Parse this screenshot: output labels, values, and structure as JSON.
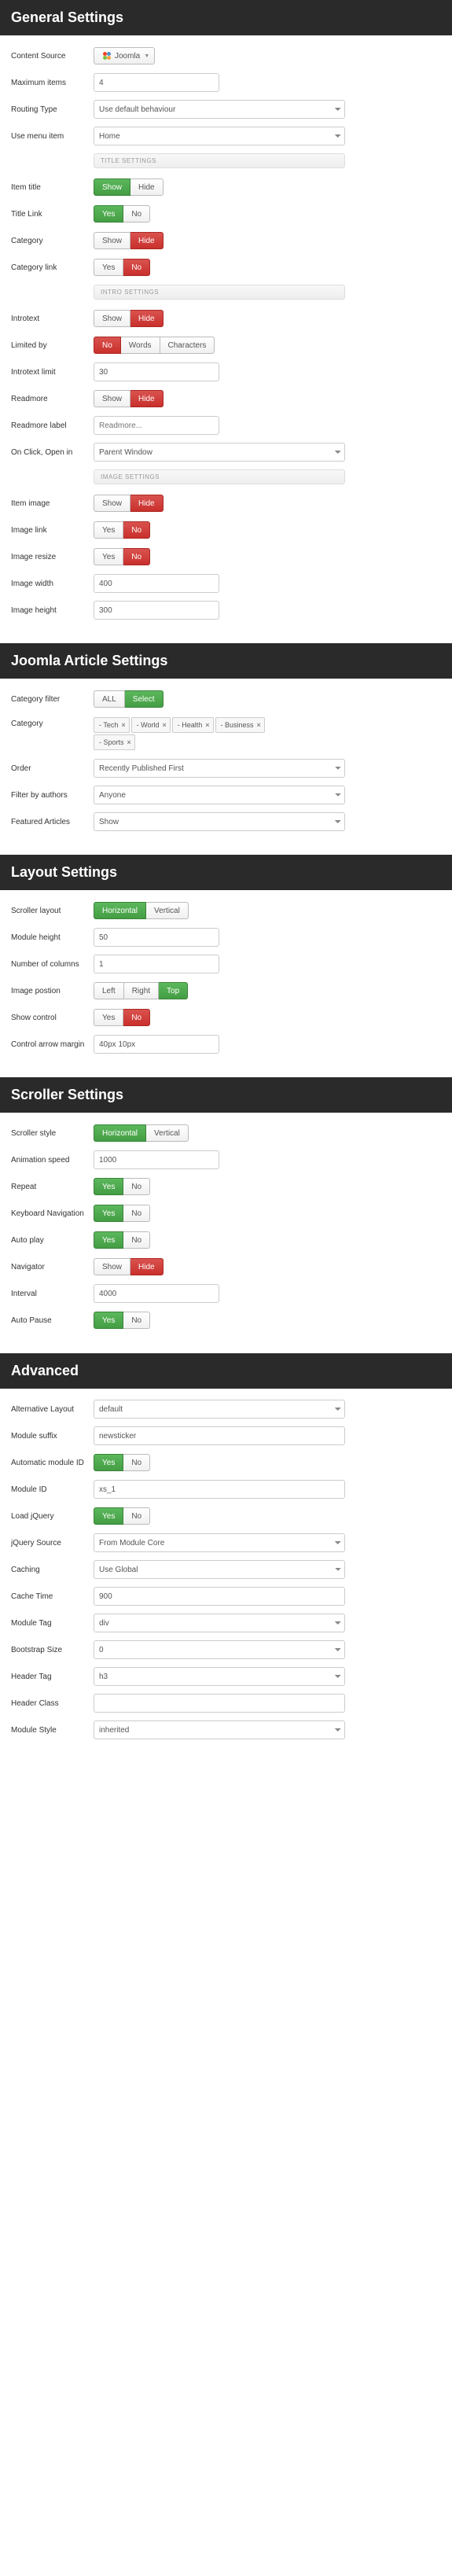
{
  "sections": {
    "general": {
      "title": "General Settings",
      "content_source_label": "Content Source",
      "content_source_value": "Joomla",
      "max_items_label": "Maximum items",
      "max_items_value": "4",
      "routing_type_label": "Routing Type",
      "routing_type_value": "Use default behaviour",
      "use_menu_label": "Use menu item",
      "use_menu_value": "Home",
      "title_settings_divider": "TITLE SETTINGS",
      "item_title_label": "Item title",
      "title_link_label": "Title Link",
      "category_label": "Category",
      "category_link_label": "Category link",
      "intro_settings_divider": "INTRO SETTINGS",
      "introtext_label": "Introtext",
      "limited_by_label": "Limited by",
      "limited_words": "Words",
      "limited_chars": "Characters",
      "introtext_limit_label": "Introtext limit",
      "introtext_limit_value": "30",
      "readmore_label": "Readmore",
      "readmore_label_label": "Readmore label",
      "readmore_label_placeholder": "Readmore...",
      "on_click_label": "On Click, Open in",
      "on_click_value": "Parent Window",
      "image_settings_divider": "IMAGE SETTINGS",
      "item_image_label": "Item image",
      "image_link_label": "Image link",
      "image_resize_label": "Image resize",
      "image_width_label": "Image width",
      "image_width_value": "400",
      "image_height_label": "Image height",
      "image_height_value": "300"
    },
    "joomla": {
      "title": "Joomla Article Settings",
      "category_filter_label": "Category filter",
      "all": "ALL",
      "select": "Select",
      "category_label": "Category",
      "tags": [
        "- Tech",
        "- World",
        "- Health",
        "- Business",
        "- Sports"
      ],
      "order_label": "Order",
      "order_value": "Recently Published First",
      "filter_authors_label": "Filter by authors",
      "filter_authors_value": "Anyone",
      "featured_label": "Featured Articles",
      "featured_value": "Show"
    },
    "layout": {
      "title": "Layout Settings",
      "scroller_layout_label": "Scroller layout",
      "horizontal": "Horizontal",
      "vertical": "Vertical",
      "module_height_label": "Module height",
      "module_height_value": "50",
      "columns_label": "Number of columns",
      "columns_value": "1",
      "image_position_label": "Image postion",
      "left": "Left",
      "right": "Right",
      "top": "Top",
      "show_control_label": "Show control",
      "arrow_margin_label": "Control arrow margin",
      "arrow_margin_value": "40px 10px"
    },
    "scroller": {
      "title": "Scroller Settings",
      "style_label": "Scroller style",
      "speed_label": "Animation speed",
      "speed_value": "1000",
      "repeat_label": "Repeat",
      "keyboard_label": "Keyboard Navigation",
      "autoplay_label": "Auto play",
      "navigator_label": "Navigator",
      "interval_label": "Interval",
      "interval_value": "4000",
      "autopause_label": "Auto Pause"
    },
    "advanced": {
      "title": "Advanced",
      "alt_layout_label": "Alternative Layout",
      "alt_layout_value": "default",
      "module_suffix_label": "Module suffix",
      "module_suffix_value": "newsticker",
      "auto_id_label": "Automatic module ID",
      "module_id_label": "Module ID",
      "module_id_value": "xs_1",
      "load_jquery_label": "Load jQuery",
      "jquery_source_label": "jQuery Source",
      "jquery_source_value": "From Module Core",
      "caching_label": "Caching",
      "caching_value": "Use Global",
      "cache_time_label": "Cache Time",
      "cache_time_value": "900",
      "module_tag_label": "Module Tag",
      "module_tag_value": "div",
      "bootstrap_label": "Bootstrap Size",
      "bootstrap_value": "0",
      "header_tag_label": "Header Tag",
      "header_tag_value": "h3",
      "header_class_label": "Header Class",
      "header_class_value": "",
      "module_style_label": "Module Style",
      "module_style_value": "inherited"
    }
  },
  "common": {
    "show": "Show",
    "hide": "Hide",
    "yes": "Yes",
    "no": "No"
  }
}
